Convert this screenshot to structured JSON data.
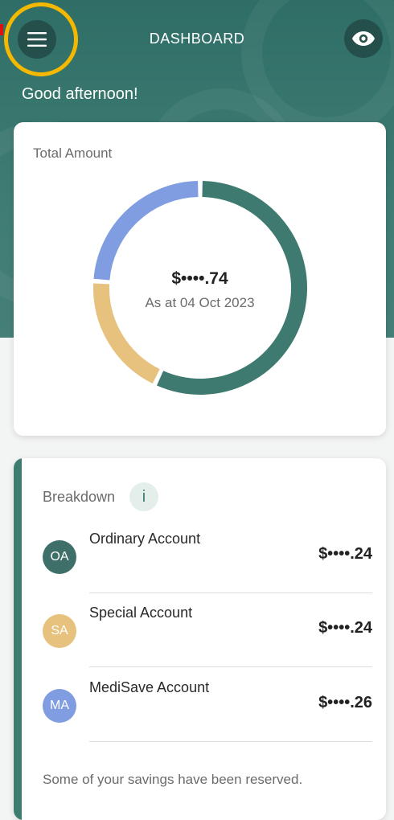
{
  "header": {
    "title": "DASHBOARD",
    "menu_icon": "hamburger-menu-icon",
    "visibility_icon": "eye-icon",
    "highlight_color": "#f5b800"
  },
  "greeting": "Good afternoon!",
  "total": {
    "label": "Total Amount",
    "amount": "$••••.74",
    "as_at": "As at 04 Oct 2023"
  },
  "chart_data": {
    "type": "pie",
    "style": "donut",
    "series": [
      {
        "name": "Ordinary Account",
        "share": 0.57,
        "color": "#3f7a70"
      },
      {
        "name": "Special Account",
        "share": 0.19,
        "color": "#e6c27e"
      },
      {
        "name": "MediSave Account",
        "share": 0.24,
        "color": "#7f9de0"
      }
    ]
  },
  "breakdown": {
    "label": "Breakdown",
    "info_label": "i",
    "items": [
      {
        "abbr": "OA",
        "name": "Ordinary Account",
        "value": "$••••.24",
        "color": "#3f6f69"
      },
      {
        "abbr": "SA",
        "name": "Special Account",
        "value": "$••••.24",
        "color": "#e6c27e"
      },
      {
        "abbr": "MA",
        "name": "MediSave Account",
        "value": "$••••.26",
        "color": "#7f9de0"
      }
    ],
    "footer": "Some of your savings have been reserved."
  }
}
